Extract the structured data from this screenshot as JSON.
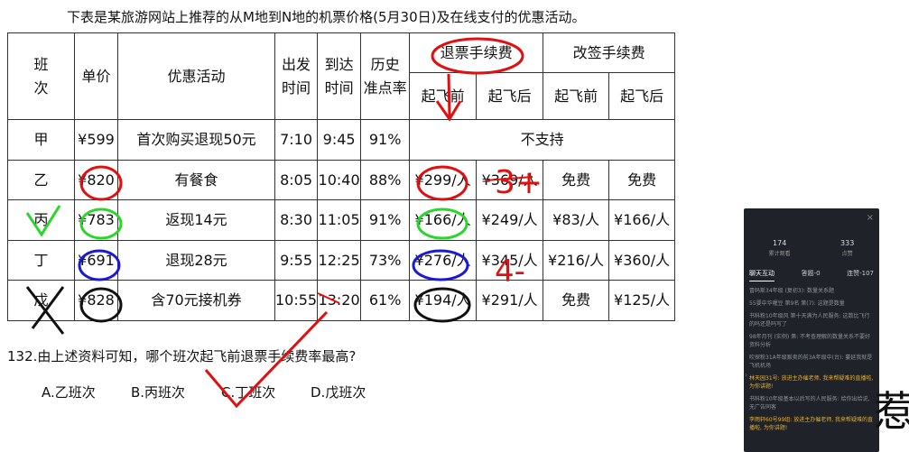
{
  "intro": "下表是某旅游网站上推荐的从M地到N地的机票价格(5月30日)及在线支付的优惠活动。",
  "headers": {
    "flight_no": [
      "班",
      "次"
    ],
    "price": "单价",
    "promo": "优惠活动",
    "depart": [
      "出发",
      "时间"
    ],
    "arrive": [
      "到达",
      "时间"
    ],
    "ontime": [
      "历史",
      "准点率"
    ],
    "refund_fee": "退票手续费",
    "change_fee": "改签手续费",
    "before": "起飞前",
    "after": "起飞后"
  },
  "rows": [
    {
      "flight": "甲",
      "price": "¥599",
      "promo": "首次购买退现50元",
      "depart": "7:10",
      "arrive": "9:45",
      "ontime": "91%",
      "no_support": "不支持"
    },
    {
      "flight": "乙",
      "price": "¥820",
      "promo": "有餐食",
      "depart": "8:05",
      "arrive": "10:40",
      "ontime": "88%",
      "refund_before": "¥299/人",
      "refund_after": "¥369/人",
      "change_before": "免费",
      "change_after": "免费"
    },
    {
      "flight": "丙",
      "price": "¥783",
      "promo": "返现14元",
      "depart": "8:30",
      "arrive": "11:05",
      "ontime": "91%",
      "refund_before": "¥166/人",
      "refund_after": "¥249/人",
      "change_before": "¥83/人",
      "change_after": "¥166/人"
    },
    {
      "flight": "丁",
      "price": "¥691",
      "promo": "退现28元",
      "depart": "9:55",
      "arrive": "12:25",
      "ontime": "73%",
      "refund_before": "¥276/人",
      "refund_after": "¥345/人",
      "change_before": "¥216/人",
      "change_after": "¥360/人"
    },
    {
      "flight": "戊",
      "price": "¥828",
      "promo": "含70元接机券",
      "depart": "10:55",
      "arrive": "13:20",
      "ontime": "61%",
      "refund_before": "¥194/人",
      "refund_after": "¥291/人",
      "change_before": "免费",
      "change_after": "¥125/人"
    }
  ],
  "question": "132.由上述资料可知，哪个班次起飞前退票手续费率最高?",
  "options": [
    "A.乙班次",
    "B.丙班次",
    "C.丁班次",
    "D.戊班次"
  ],
  "annotations": {
    "plus": "3+",
    "minus": "4-"
  },
  "live_panel": {
    "close": "×",
    "stats": [
      {
        "num": "174",
        "label": "累计观看"
      },
      {
        "num": "333",
        "label": "点赞"
      }
    ],
    "tabs": [
      "聊天互动",
      "答题-0",
      "连赞-107"
    ],
    "messages": [
      {
        "text": "冒码斯34年级 (复初3): 数量关系题",
        "highlight": false
      },
      {
        "text": "55婴中华喔豆 第9名 第(7): 这题是数量",
        "highlight": false
      },
      {
        "text": "书科粉10年级风 第十天满为人民服务: 这数比飞行的吗还是吗写了",
        "highlight": false
      },
      {
        "text": "98年月刊 (实例) 第: 不考查理解的数量关系不要好资料分析",
        "highlight": false
      },
      {
        "text": "吹探粉31A年级贩卖的前3A年级中(台): 蔓延我就是飞机机场",
        "highlight": false
      },
      {
        "text": "林天园31号: 放进主办催老师, 我来帮疑难的直播啦, 为你讲题!",
        "highlight": true
      },
      {
        "text": "书科粉10年级基本以后写的人民服务: 给你出给说, 无广告同客",
        "highlight": false
      },
      {
        "text": "李雨轩60号99组: 放进主办催老师, 我来帮疑难的直播啦, 为你讲题!",
        "highlight": true
      }
    ]
  },
  "calligraphy": "惹",
  "colors": {
    "red": "#e01010",
    "green": "#2bd52b",
    "blue": "#1a1ad6",
    "black": "#111111"
  }
}
